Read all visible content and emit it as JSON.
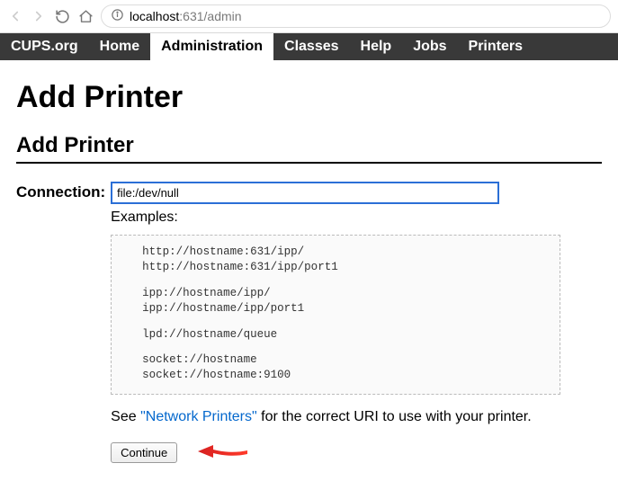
{
  "browser": {
    "url_host": "localhost",
    "url_path": ":631/admin"
  },
  "nav": {
    "brand": "CUPS.org",
    "items": [
      "Home",
      "Administration",
      "Classes",
      "Help",
      "Jobs",
      "Printers"
    ],
    "active_index": 1
  },
  "page": {
    "title": "Add Printer",
    "subtitle": "Add Printer"
  },
  "form": {
    "connection_label": "Connection:",
    "connection_value": "file:/dev/null",
    "examples_label": "Examples:",
    "examples": [
      [
        "http://hostname:631/ipp/",
        "http://hostname:631/ipp/port1"
      ],
      [
        "ipp://hostname/ipp/",
        "ipp://hostname/ipp/port1"
      ],
      [
        "lpd://hostname/queue"
      ],
      [
        "socket://hostname",
        "socket://hostname:9100"
      ]
    ],
    "hint_prefix": "See ",
    "hint_link": "\"Network Printers\"",
    "hint_suffix": " for the correct URI to use with your printer.",
    "continue_label": "Continue"
  }
}
